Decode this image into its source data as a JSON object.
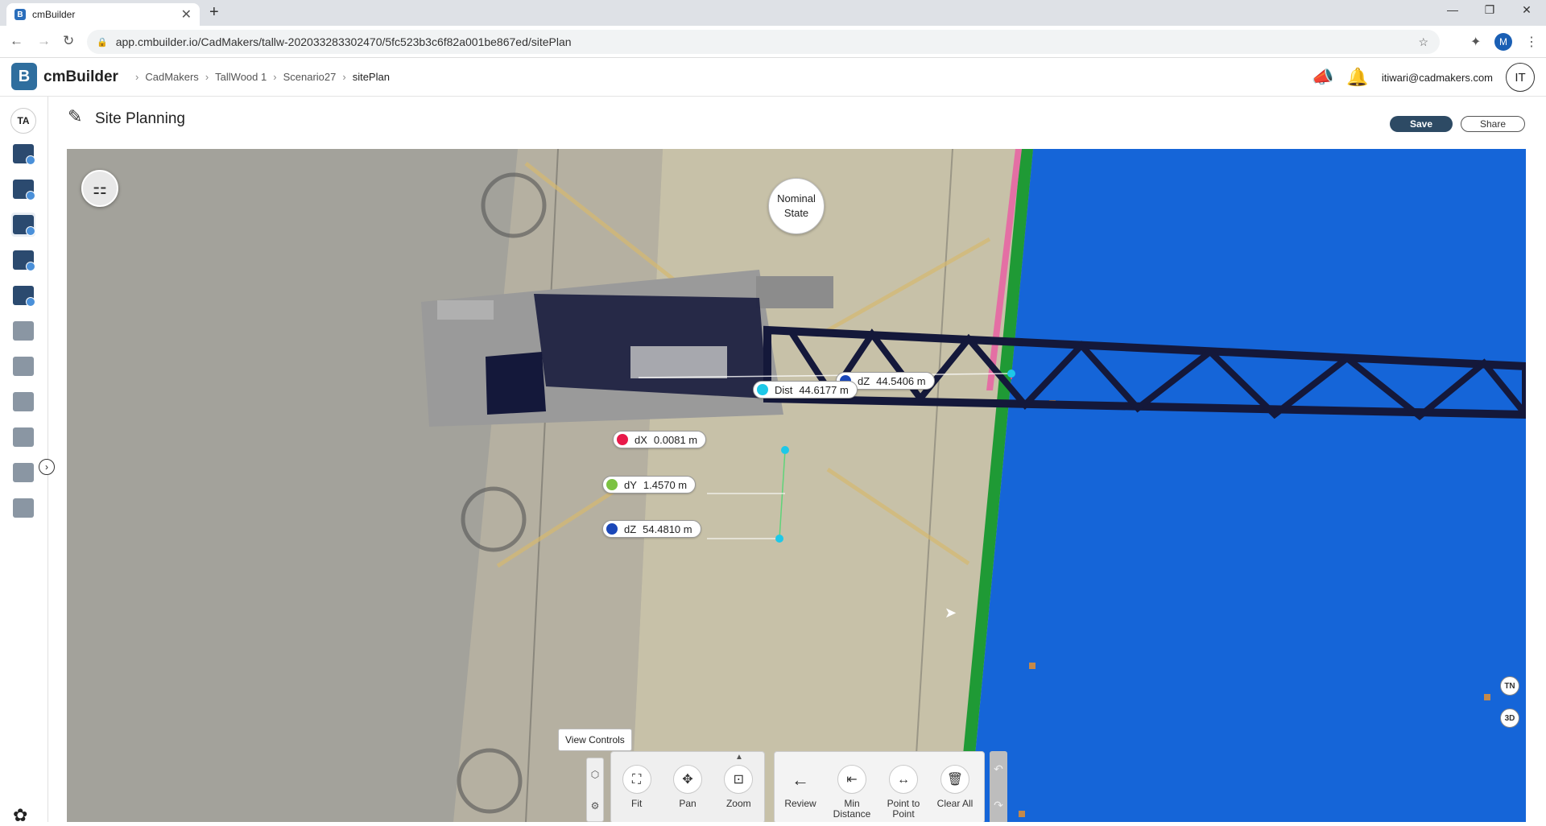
{
  "browser": {
    "tab_title": "cmBuilder",
    "tab_close": "✕",
    "new_tab": "+",
    "url": "app.cmbuilder.io/CadMakers/tallw-202033283302470/5fc523b3c6f82a001be867ed/sitePlan",
    "profile_initial": "M"
  },
  "header": {
    "logo_letter": "B",
    "brand": "cmBuilder",
    "breadcrumbs": [
      "CadMakers",
      "TallWood 1",
      "Scenario27",
      "sitePlan"
    ],
    "user_email": "itiwari@cadmakers.com",
    "user_initials": "IT"
  },
  "sidebar": {
    "user_badge": "TA",
    "items": [
      "analytics-1",
      "analytics-2",
      "site-planning",
      "schedule",
      "layers",
      "tools",
      "sheets",
      "settings",
      "workflow",
      "reports",
      "documents"
    ],
    "active": "site-planning"
  },
  "page": {
    "title": "Site Planning",
    "save_label": "Save",
    "share_label": "Share"
  },
  "viewport": {
    "state_label_line1": "Nominal",
    "state_label_line2": "State",
    "measurements": {
      "dist": {
        "label": "Dist",
        "value": "44.6177 m",
        "color": "#1ec8e8"
      },
      "dz_top": {
        "label": "dZ",
        "value": "44.5406 m",
        "color": "#1a47b8"
      },
      "dx": {
        "label": "dX",
        "value": "0.0081 m",
        "color": "#e8194a"
      },
      "dy": {
        "label": "dY",
        "value": "1.4570 m",
        "color": "#7cc242"
      },
      "dz": {
        "label": "dZ",
        "value": "54.4810 m",
        "color": "#1a47b8"
      }
    },
    "nav_north": "TN",
    "nav_3d": "3D"
  },
  "toolbar": {
    "view_controls_tooltip": "View Controls",
    "view_buttons": [
      {
        "label": "Fit",
        "icon": "fit-icon"
      },
      {
        "label": "Pan",
        "icon": "pan-icon"
      },
      {
        "label": "Zoom",
        "icon": "zoom-icon"
      }
    ],
    "measure_buttons": [
      {
        "label": "Review",
        "icon": "back-arrow-icon"
      },
      {
        "label": "Min Distance",
        "icon": "min-distance-icon"
      },
      {
        "label": "Point to Point",
        "icon": "point-to-point-icon"
      },
      {
        "label": "Clear All",
        "icon": "trash-icon"
      }
    ]
  },
  "colors": {
    "accent": "#2d4a64",
    "building_blue": "#1565d8",
    "crane": "#14183a"
  }
}
